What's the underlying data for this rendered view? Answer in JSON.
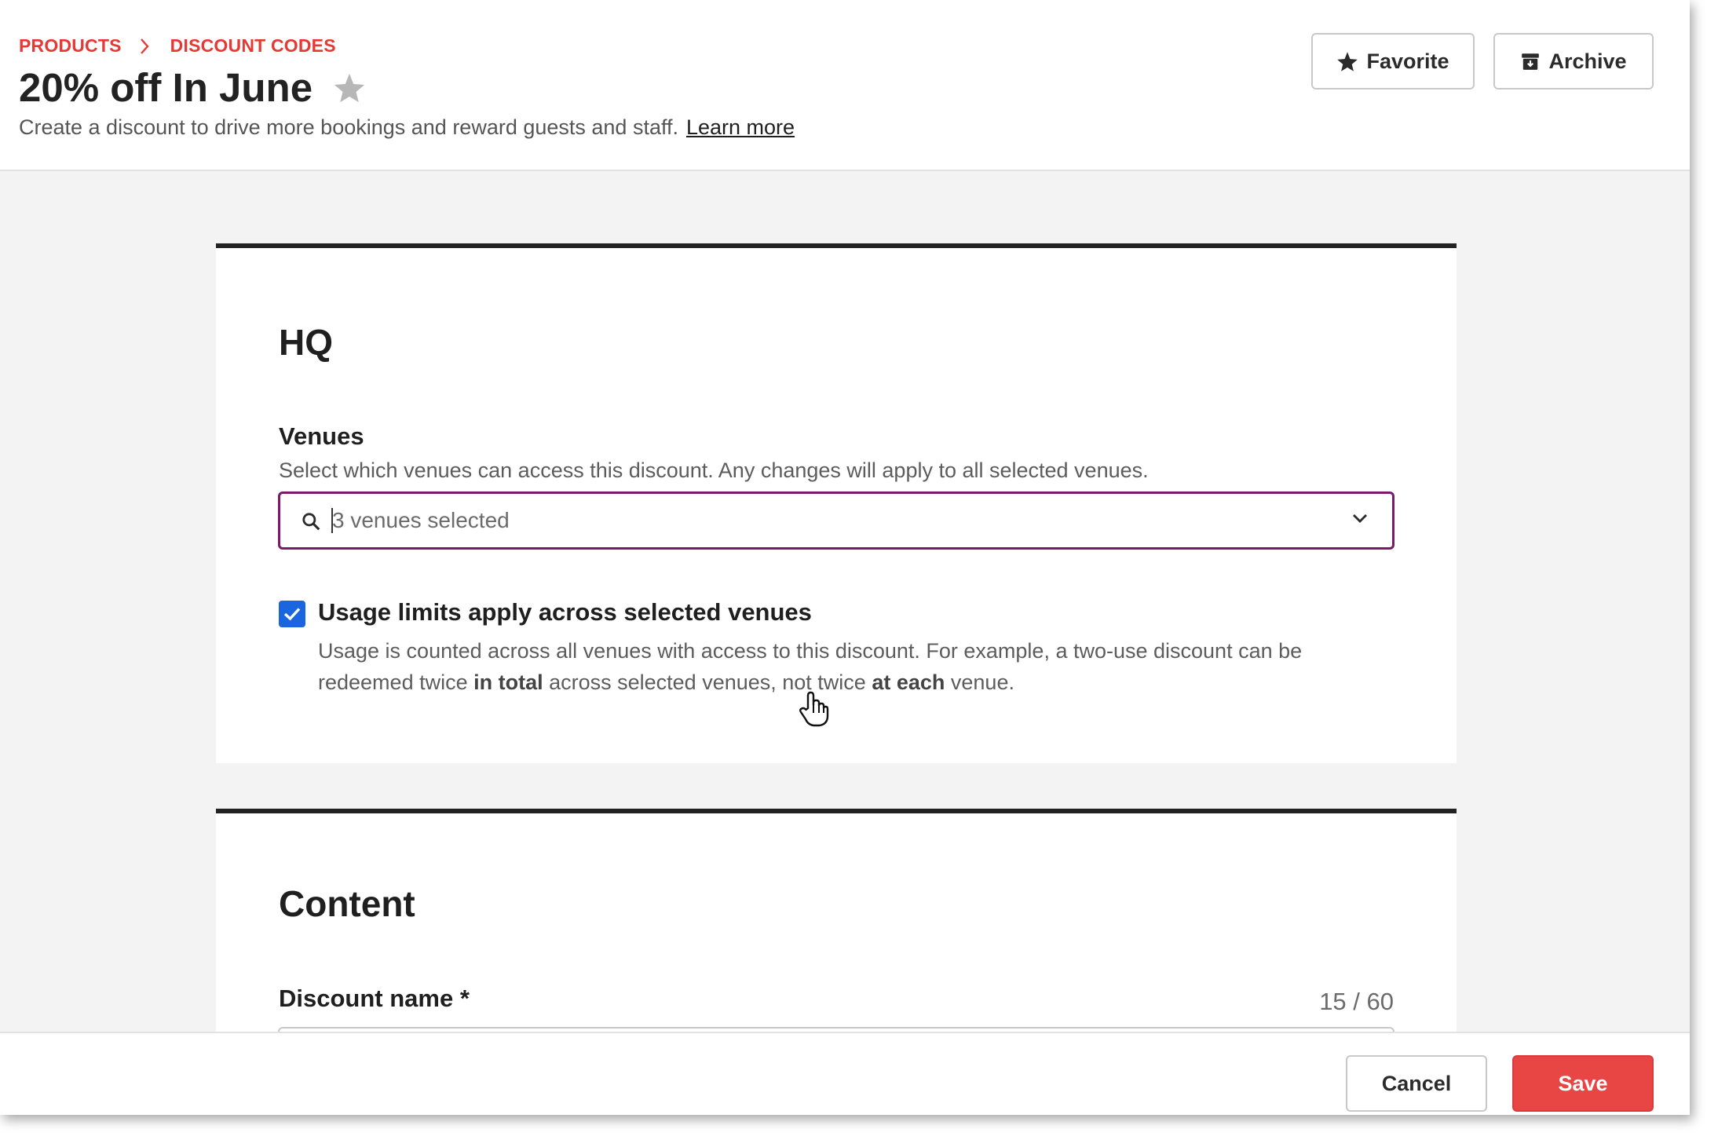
{
  "header": {
    "breadcrumb": [
      "PRODUCTS",
      "DISCOUNT CODES"
    ],
    "title": "20% off In June",
    "subtitle": "Create a discount to drive more bookings and reward guests and staff.",
    "learn_more": "Learn more",
    "favorite_label": "Favorite",
    "archive_label": "Archive"
  },
  "hq": {
    "title": "HQ",
    "venues_label": "Venues",
    "venues_help": "Select which venues can access this discount. Any changes will apply to all selected venues.",
    "venues_value": "3 venues selected",
    "usage_checked": true,
    "usage_label": "Usage limits apply across selected venues",
    "usage_help": {
      "part1": "Usage is counted across all venues with access to this discount. For example, a two-use discount can be redeemed twice ",
      "bold1": "in total",
      "part2": " across selected venues, not twice ",
      "bold2": "at each",
      "part3": " venue."
    }
  },
  "content": {
    "title": "Content",
    "name_label": "Discount name *",
    "name_count": "15 / 60"
  },
  "footer": {
    "cancel_label": "Cancel",
    "save_label": "Save"
  },
  "colors": {
    "accent_red": "#e53935",
    "select_border": "#7b1a6a",
    "checkbox_blue": "#1a66e0",
    "save_bg": "#e84545"
  },
  "icons": [
    "chevron-right-icon",
    "star-outline-icon",
    "star-icon",
    "archive-icon",
    "search-icon",
    "chevron-down-icon",
    "checkmark-icon",
    "hand-cursor-icon"
  ]
}
